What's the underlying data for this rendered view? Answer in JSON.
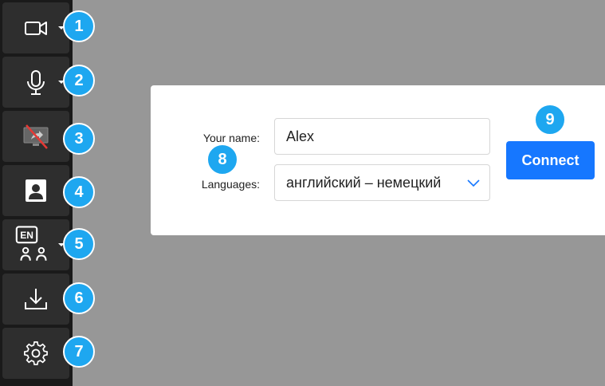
{
  "sidebar": {
    "tools": [
      {
        "icon": "video-camera-icon",
        "badge": "1",
        "has_dropdown": true
      },
      {
        "icon": "microphone-icon",
        "badge": "2",
        "has_dropdown": true
      },
      {
        "icon": "screen-share-off-icon",
        "badge": "3",
        "has_dropdown": false
      },
      {
        "icon": "user-portrait-icon",
        "badge": "4",
        "has_dropdown": false
      },
      {
        "icon": "language-users-icon",
        "badge": "5",
        "has_dropdown": true,
        "icon_label": "EN"
      },
      {
        "icon": "download-icon",
        "badge": "6",
        "has_dropdown": false
      },
      {
        "icon": "gear-icon",
        "badge": "7",
        "has_dropdown": false
      }
    ]
  },
  "form": {
    "name_label": "Your name:",
    "name_value": "Alex",
    "languages_label": "Languages:",
    "languages_value": "английский – немецкий",
    "badge": "8"
  },
  "connect": {
    "label": "Connect",
    "badge": "9"
  },
  "colors": {
    "sidebar_bg": "#1a1a1a",
    "tool_bg": "#2e2e2e",
    "background": "#979797",
    "badge": "#1ea7f0",
    "accent": "#1677ff",
    "screen_off_slash": "#e53935"
  }
}
